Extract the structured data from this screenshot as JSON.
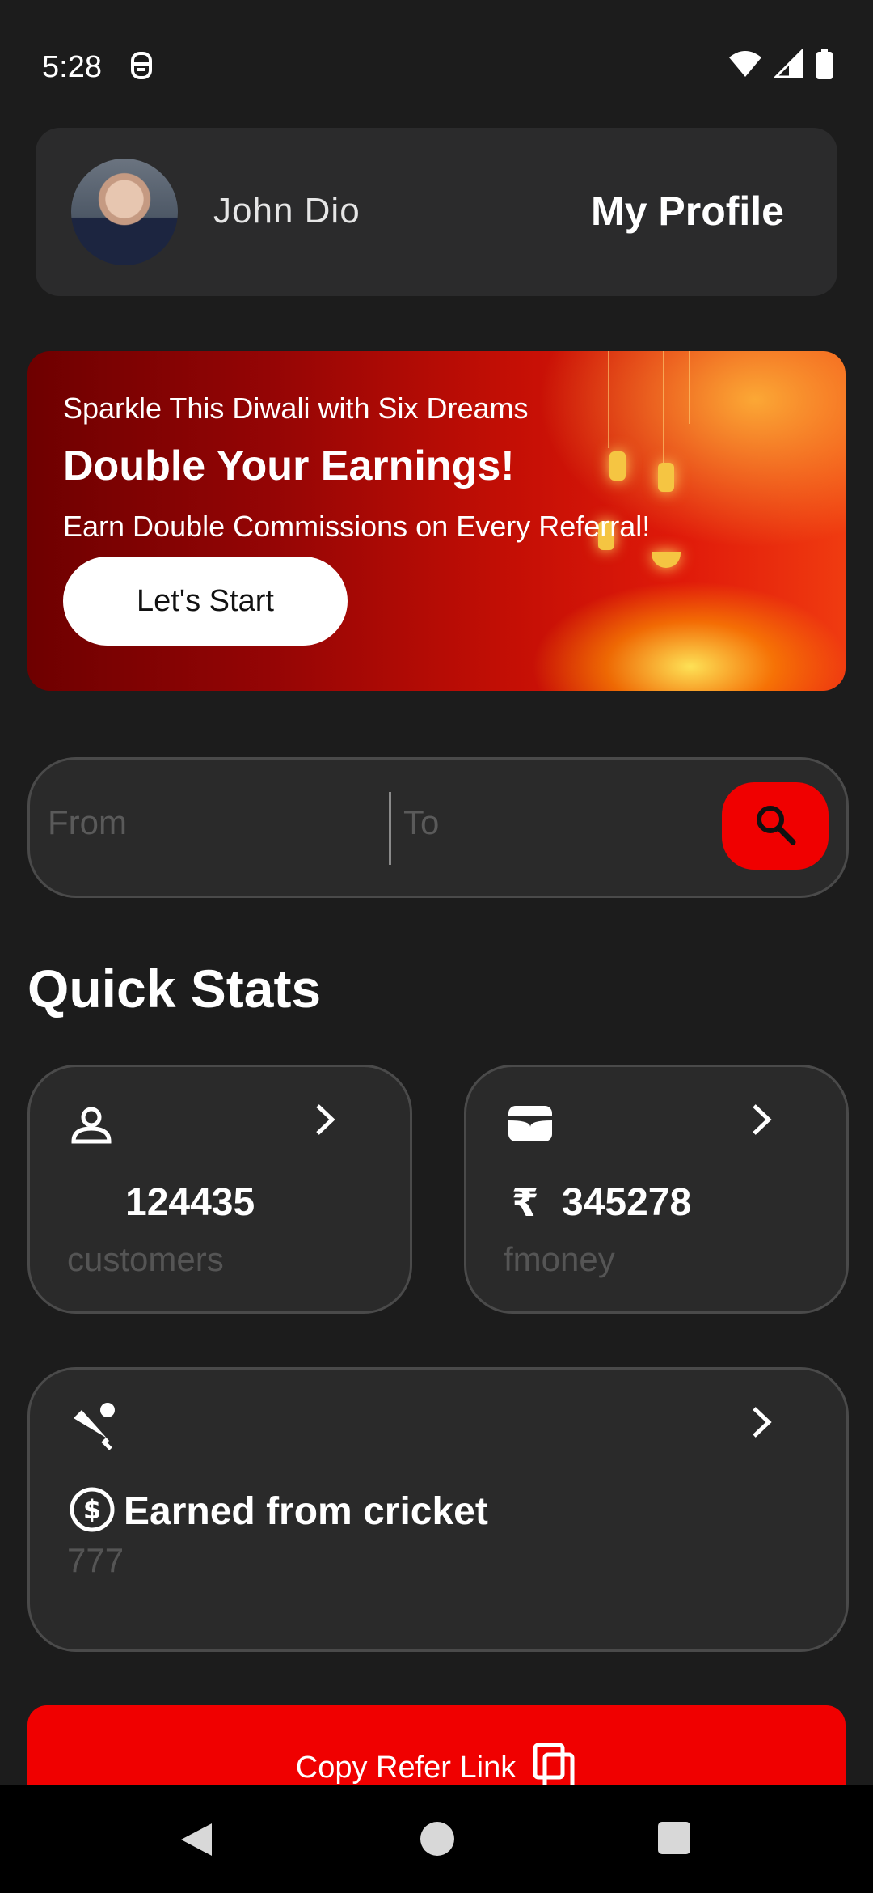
{
  "status_bar": {
    "time": "5:28"
  },
  "profile": {
    "name": "John Dio",
    "link_label": "My Profile"
  },
  "banner": {
    "eyebrow": "Sparkle This Diwali with Six Dreams",
    "title": "Double Your Earnings!",
    "subtitle": "Earn Double Commissions on Every Referral!",
    "button_label": "Let's Start"
  },
  "search": {
    "from_placeholder": "From",
    "to_placeholder": "To"
  },
  "quick_stats": {
    "title": "Quick Stats",
    "customers": {
      "value": "124435",
      "label": "customers"
    },
    "money": {
      "currency": "₹",
      "value": "345278",
      "label": "fmoney"
    },
    "cricket": {
      "title": "Earned from cricket",
      "value": "777"
    }
  },
  "cta": {
    "label": "Copy Refer Link"
  },
  "colors": {
    "accent": "#f00000",
    "background": "#1c1c1c",
    "card": "#2a2a2a"
  }
}
